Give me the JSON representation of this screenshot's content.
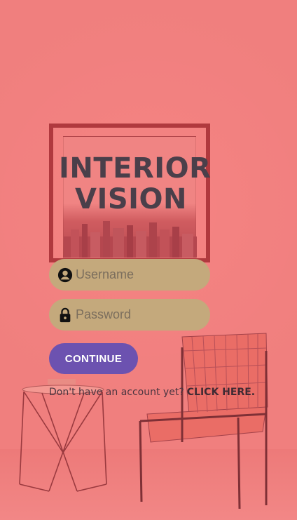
{
  "brand": {
    "line1": "INTERIOR",
    "line2": "VISION"
  },
  "form": {
    "username_placeholder": "Username",
    "password_placeholder": "Password",
    "continue_label": "CONTINUE"
  },
  "signup": {
    "prompt": "Don't have an account yet?",
    "link_label": "CLICK HERE."
  },
  "icons": {
    "username": "account-circle-icon",
    "password": "lock-icon"
  },
  "colors": {
    "background": "#f07f7e",
    "input_fill": "#c4a97c",
    "button": "#6c52b0",
    "title": "#4a3f4a"
  }
}
